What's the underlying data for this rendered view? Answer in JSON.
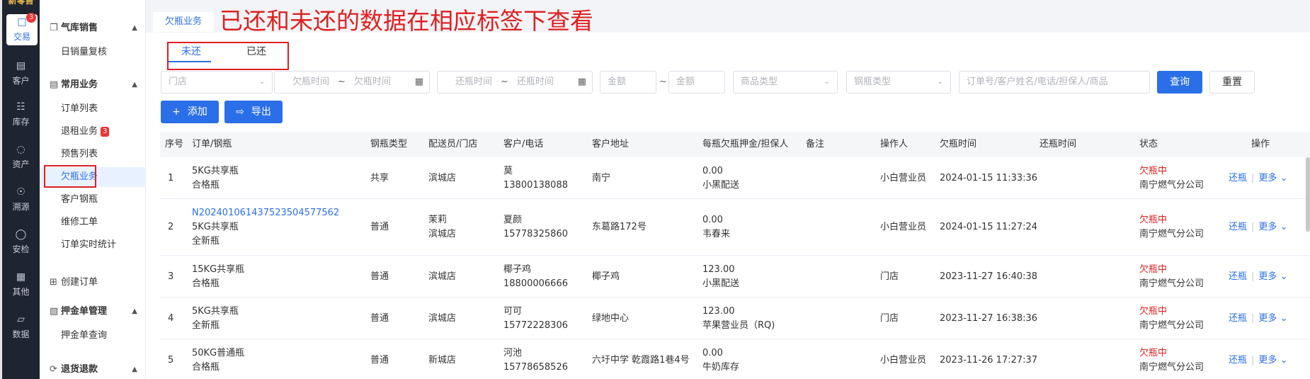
{
  "rail": {
    "logo": "新零售",
    "items": [
      {
        "label": "交易",
        "icon": "bag-icon",
        "badge": "3"
      },
      {
        "label": "客户",
        "icon": "id-card-icon"
      },
      {
        "label": "库存",
        "icon": "list-icon"
      },
      {
        "label": "资产",
        "icon": "bulb-icon"
      },
      {
        "label": "溯源",
        "icon": "compass-icon"
      },
      {
        "label": "安检",
        "icon": "shield-icon"
      },
      {
        "label": "其他",
        "icon": "grid-icon"
      },
      {
        "label": "数据",
        "icon": "chart-icon"
      }
    ]
  },
  "sidebar": {
    "g1": "气库销售",
    "g1_items": [
      "日销量复核"
    ],
    "g2": "常用业务",
    "g2_items": [
      {
        "label": "订单列表"
      },
      {
        "label": "退租业务",
        "badge": "3"
      },
      {
        "label": "预售列表"
      },
      {
        "label": "欠瓶业务"
      },
      {
        "label": "客户钢瓶"
      },
      {
        "label": "维修工单"
      },
      {
        "label": "订单实时统计"
      }
    ],
    "g3": "创建订单",
    "g4": "押金单管理",
    "g4_items": [
      "押金单查询"
    ],
    "g5": "退货退款"
  },
  "page_tab": "欠瓶业务",
  "annotation": "已还和未还的数据在相应标签下查看",
  "subtabs": [
    "未还",
    "已还"
  ],
  "filters": {
    "store": "门店",
    "owe_start": "欠瓶时间",
    "owe_end": "欠瓶时间",
    "ret_start": "还瓶时间",
    "ret_end": "还瓶时间",
    "amt_min": "金额",
    "amt_max": "金额",
    "goods_type": "商品类型",
    "cyl_type": "钢瓶类型",
    "keyword": "订单号/客户姓名/电话/担保人/商品",
    "tilde": "~"
  },
  "buttons": {
    "query": "查询",
    "reset": "重置",
    "add": "添加",
    "export": "导出"
  },
  "table": {
    "headers": [
      "序号",
      "订单/钢瓶",
      "钢瓶类型",
      "配送员/门店",
      "客户/电话",
      "客户地址",
      "每瓶欠瓶押金/担保人",
      "备注",
      "操作人",
      "欠瓶时间",
      "还瓶时间",
      "状态",
      "操作"
    ],
    "rows": [
      {
        "no": "1",
        "order": "",
        "cyl": "5KG共享瓶",
        "cond": "合格瓶",
        "type": "共享",
        "courier": "",
        "store": "滨城店",
        "name": "莫",
        "phone": "13800138088",
        "addr": "南宁",
        "deposit": "0.00",
        "guarantor": "小黑配送",
        "remark": "",
        "operator": "小白营业员",
        "owe_time": "2024-01-15 11:33:36",
        "ret_time": "",
        "status": "欠瓶中",
        "company": "南宁燃气分公司",
        "act1": "还瓶",
        "act2": "更多"
      },
      {
        "no": "2",
        "order": "N202401061437523504577562",
        "cyl": "5KG共享瓶",
        "cond": "全新瓶",
        "type": "普通",
        "courier": "茉莉",
        "store": "滨城店",
        "name": "夏颜",
        "phone": "15778325860",
        "addr": "东葛路172号",
        "deposit": "0.00",
        "guarantor": "韦春来",
        "remark": "",
        "operator": "小白营业员",
        "owe_time": "2024-01-15 11:27:24",
        "ret_time": "",
        "status": "欠瓶中",
        "company": "南宁燃气分公司",
        "act1": "还瓶",
        "act2": "更多"
      },
      {
        "no": "3",
        "order": "",
        "cyl": "15KG共享瓶",
        "cond": "合格瓶",
        "type": "普通",
        "courier": "",
        "store": "滨城店",
        "name": "椰子鸡",
        "phone": "18800006666",
        "addr": "椰子鸡",
        "deposit": "123.00",
        "guarantor": "小黑配送",
        "remark": "",
        "operator": "门店",
        "owe_time": "2023-11-27 16:40:38",
        "ret_time": "",
        "status": "欠瓶中",
        "company": "南宁燃气分公司",
        "act1": "还瓶",
        "act2": "更多"
      },
      {
        "no": "4",
        "order": "",
        "cyl": "5KG共享瓶",
        "cond": "全新瓶",
        "type": "普通",
        "courier": "",
        "store": "滨城店",
        "name": "可可",
        "phone": "15772228306",
        "addr": "绿地中心",
        "deposit": "123.00",
        "guarantor": "苹果营业员（RQ)",
        "remark": "",
        "operator": "门店",
        "owe_time": "2023-11-27 16:38:36",
        "ret_time": "",
        "status": "欠瓶中",
        "company": "南宁燃气分公司",
        "act1": "还瓶",
        "act2": "更多"
      },
      {
        "no": "5",
        "order": "",
        "cyl": "50KG普通瓶",
        "cond": "合格瓶",
        "type": "普通",
        "courier": "",
        "store": "新城店",
        "name": "河池",
        "phone": "15778658526",
        "addr": "六圩中学 乾霞路1巷4号",
        "deposit": "0.00",
        "guarantor": "牛奶库存",
        "remark": "",
        "operator": "小白营业员",
        "owe_time": "2023-11-26 17:27:37",
        "ret_time": "",
        "status": "欠瓶中",
        "company": "南宁燃气分公司",
        "act1": "还瓶",
        "act2": "更多"
      }
    ]
  }
}
